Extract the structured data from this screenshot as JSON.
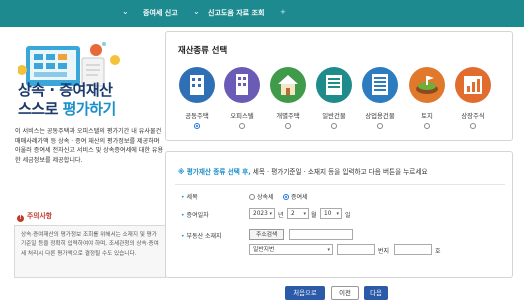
{
  "topbar": {
    "crumb1": "증여세 신고",
    "crumb2": "신고도움 자료 조회",
    "crumb2_suffix": "+"
  },
  "left": {
    "title_line1": "상속 · 증여재산",
    "title_line2_a": "스스로 ",
    "title_line2_b": "평가하기",
    "intro": "이 서비스는 공동주택과 오피스텔의 평가기간 내 유사물건 매매사례가액 등 상속 · 증여 재산의 평가정보를 제공하며 아울러 증여세 전자신고 서비스 및 상속증여세에 대한 유용한 세금정보를 제공합니다.",
    "notice_title": "주의사항",
    "notice_text": "상속·증여재산의 평가정보 조회를 위해서는 소재지 및 평가기준일 등을 정확히 입력하여야 하며, 조세관청의 상속·증여세 처리시 다른 평가액으로 결정될 수도 있습니다."
  },
  "assets": {
    "title": "재산종류 선택",
    "items": [
      {
        "label": "공동주택",
        "icon": "apartment-icon",
        "color": "#2f6fb6",
        "selected": true
      },
      {
        "label": "오피스텔",
        "icon": "office-building-icon",
        "color": "#6a5bb7",
        "selected": false
      },
      {
        "label": "개별주택",
        "icon": "house-icon",
        "color": "#3f9a4a",
        "selected": false
      },
      {
        "label": "일반건물",
        "icon": "building-icon",
        "color": "#1f8b8a",
        "selected": false
      },
      {
        "label": "상업용건물",
        "icon": "commercial-building-icon",
        "color": "#2d7cbf",
        "selected": false
      },
      {
        "label": "토지",
        "icon": "land-icon",
        "color": "#e0792b",
        "selected": false
      },
      {
        "label": "상장주식",
        "icon": "stock-chart-icon",
        "color": "#e26b2e",
        "selected": false
      }
    ]
  },
  "form": {
    "head_accent": "※ 평가재산 종류 선택 후,",
    "head_text": " 세목 · 평가기준일 · 소재지 등을 입력하고 다음 버튼을 누르세요",
    "tax_label": "세목",
    "tax_options": [
      {
        "label": "상속세",
        "selected": false
      },
      {
        "label": "증여세",
        "selected": true
      }
    ],
    "date_label": "증여일자",
    "year_value": "2023",
    "year_unit": "년",
    "month_value": "2",
    "month_unit": "월",
    "day_value": "10",
    "day_unit": "일",
    "address_label": "부동산 소재지",
    "address_search_button": "주소검색",
    "lot_type_value": "일반지번",
    "bunji_label": "번지",
    "ho_label": "호"
  },
  "buttons": {
    "reset": "처음으로",
    "prev": "이전",
    "next": "다음"
  }
}
